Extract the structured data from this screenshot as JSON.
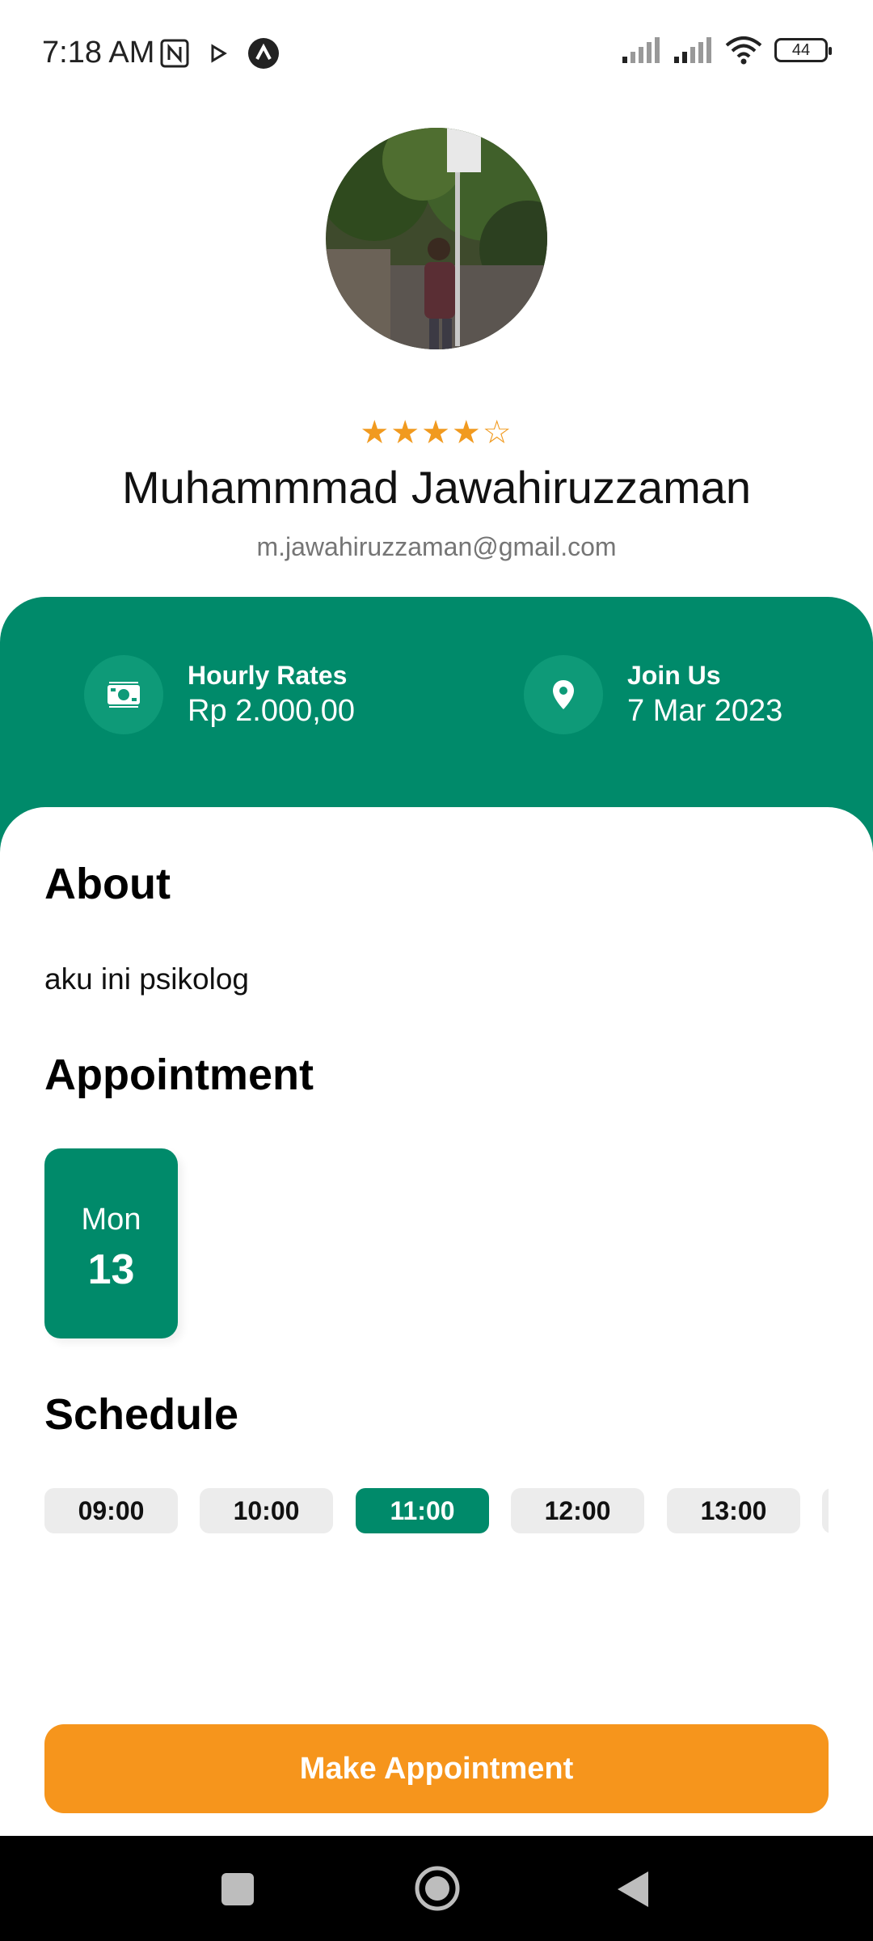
{
  "status_bar": {
    "time": "7:18 AM",
    "battery": "44",
    "icons": [
      "nfc-icon",
      "play-icon",
      "app-notification-icon",
      "signal-icon",
      "signal-icon",
      "wifi-icon",
      "battery-icon"
    ]
  },
  "profile": {
    "rating": "★★★★☆",
    "rating_value": 4,
    "rating_max": 5,
    "name": "Muhammmad Jawahiruzzaman",
    "email": "m.jawahiruzzaman@gmail.com"
  },
  "info": {
    "hourly_label": "Hourly Rates",
    "hourly_value": "Rp 2.000,00",
    "join_label": "Join Us",
    "join_value": "7 Mar 2023"
  },
  "about": {
    "title": "About",
    "text": "aku ini psikolog"
  },
  "appointment": {
    "title": "Appointment",
    "day_name": "Mon",
    "day_number": "13"
  },
  "schedule": {
    "title": "Schedule",
    "slots": [
      "09:00",
      "10:00",
      "11:00",
      "12:00",
      "13:00"
    ],
    "selected": "11:00"
  },
  "cta": {
    "label": "Make Appointment"
  },
  "colors": {
    "primary": "#008a6a",
    "accent": "#f6951c",
    "star": "#f19a1f"
  }
}
